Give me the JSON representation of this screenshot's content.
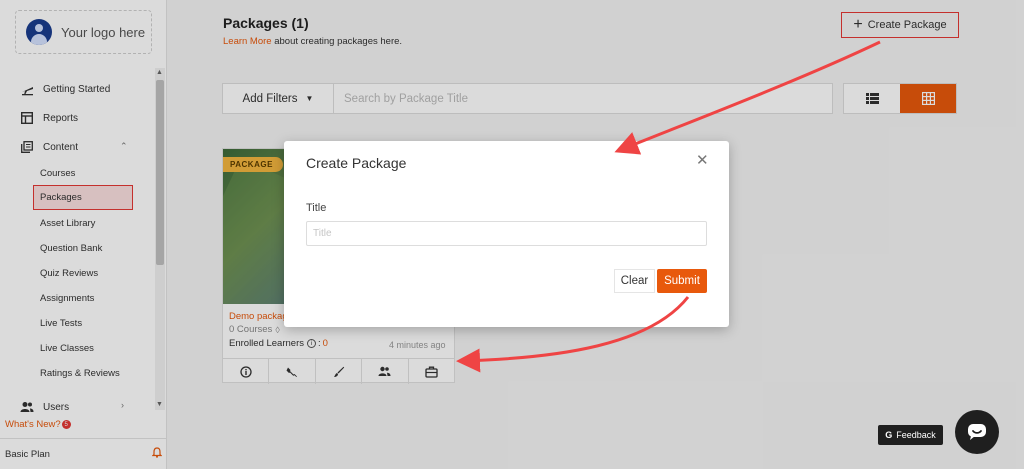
{
  "sidebar": {
    "logo_text": "Your logo here",
    "items": [
      {
        "label": "Getting Started",
        "icon": "plane-icon"
      },
      {
        "label": "Reports",
        "icon": "table-icon"
      },
      {
        "label": "Content",
        "icon": "content-icon"
      }
    ],
    "content_sub": [
      "Courses",
      "Packages",
      "Asset Library",
      "Question Bank",
      "Quiz Reviews",
      "Assignments",
      "Live Tests",
      "Live Classes",
      "Ratings & Reviews"
    ],
    "active_sub": "Packages",
    "users_label": "Users",
    "whats_new": "What's New?",
    "whats_new_badge": "5",
    "plan": "Basic Plan"
  },
  "header": {
    "title": "Packages (1)",
    "learn_more_link": "Learn More",
    "learn_more_text": " about creating packages here.",
    "create_button": "Create Package"
  },
  "filters": {
    "add_filters": "Add Filters",
    "search_placeholder": "Search by Package Title"
  },
  "card": {
    "badge": "PACKAGE",
    "title": "Demo package",
    "courses": "0 Courses",
    "learners_label": "Enrolled Learners",
    "learners_count": "0",
    "time": "4 minutes ago"
  },
  "modal": {
    "title": "Create Package",
    "field_label": "Title",
    "field_placeholder": "Title",
    "field_value": "",
    "clear": "Clear",
    "submit": "Submit"
  },
  "feedback": {
    "label": "Feedback",
    "glyph": "G"
  },
  "colors": {
    "accent": "#e8590c",
    "highlight": "#e53935"
  }
}
